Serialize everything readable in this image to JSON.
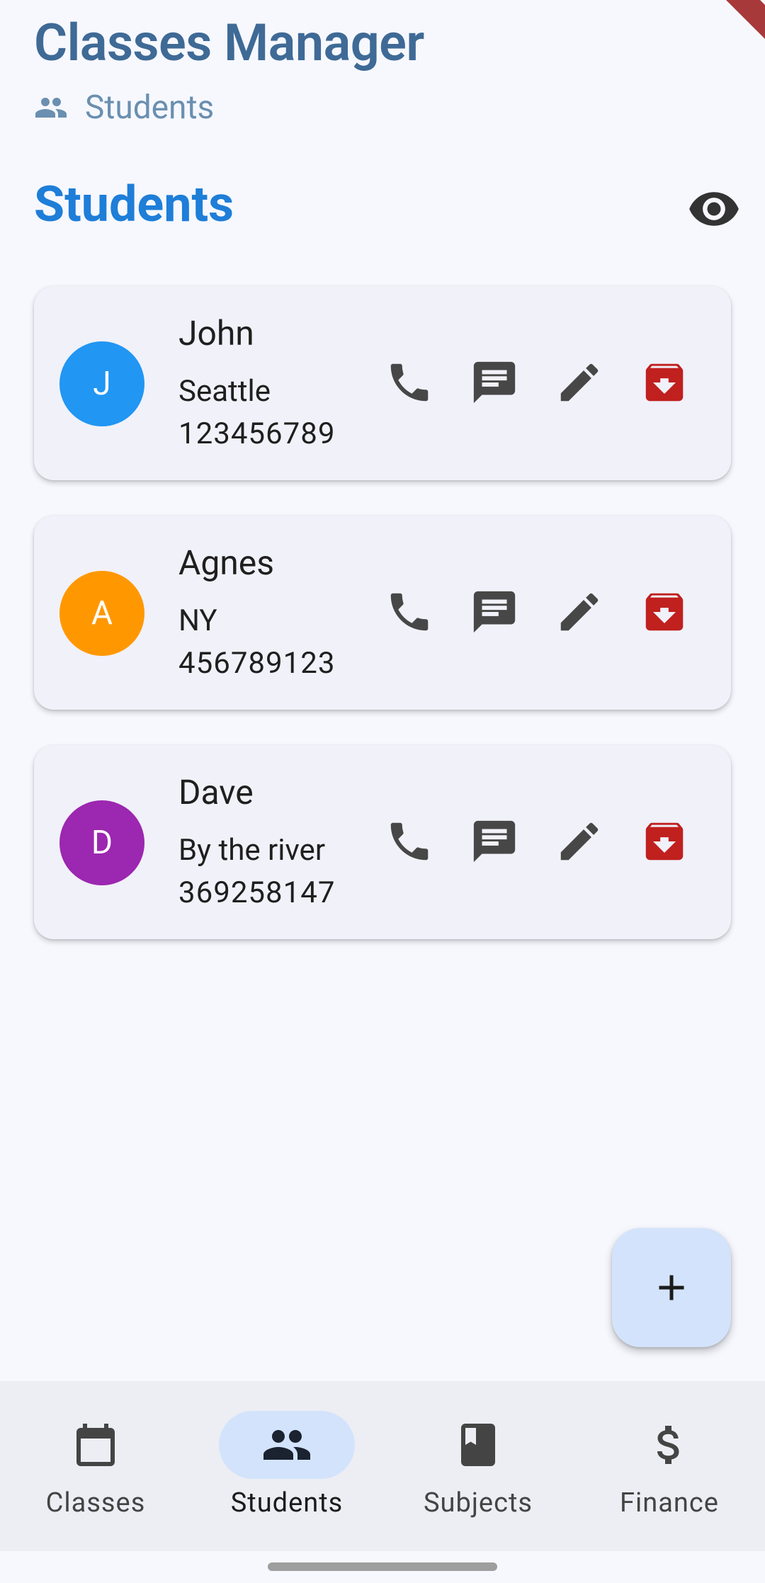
{
  "header": {
    "title": "Classes Manager",
    "subtitle": "Students",
    "subtitle_icon": "people-icon"
  },
  "section": {
    "title": "Students",
    "toggle_icon": "eye-icon"
  },
  "students": [
    {
      "initial": "J",
      "name": "John",
      "address": "Seattle",
      "phone": "123456789",
      "avatar_color": "#2196f3"
    },
    {
      "initial": "A",
      "name": "Agnes",
      "address": "NY",
      "phone": "456789123",
      "avatar_color": "#ff9800"
    },
    {
      "initial": "D",
      "name": "Dave",
      "address": "By the river",
      "phone": "369258147",
      "avatar_color": "#9c27b0"
    }
  ],
  "card_actions": [
    "phone-icon",
    "message-icon",
    "edit-icon",
    "archive-icon"
  ],
  "fab": {
    "icon": "add-icon"
  },
  "bottom_nav": {
    "items": [
      {
        "label": "Classes",
        "icon": "calendar-icon",
        "active": false
      },
      {
        "label": "Students",
        "icon": "people-icon",
        "active": true
      },
      {
        "label": "Subjects",
        "icon": "book-icon",
        "active": false
      },
      {
        "label": "Finance",
        "icon": "dollar-icon",
        "active": false
      }
    ]
  },
  "colors": {
    "accent": "#1e7ed8",
    "title": "#3f6a96",
    "delete": "#c0201e",
    "active_pill": "#d3e3fb"
  }
}
